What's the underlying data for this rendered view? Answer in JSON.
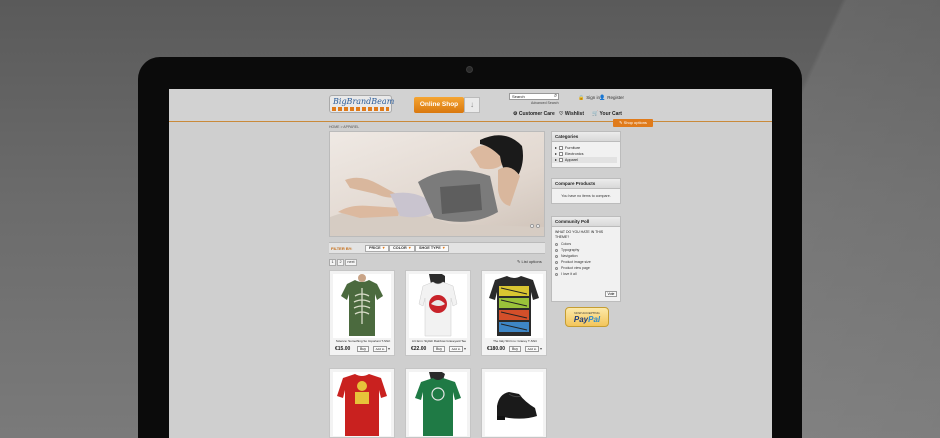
{
  "header": {
    "logo_text": "BigBrandBeam",
    "online_shop_label": "Online Shop",
    "search_placeholder": "Search",
    "advanced_search": "Advanced Search",
    "sign_in": "Sign in",
    "register": "Register",
    "customer_care": "Customer Care",
    "wishlist": "Wishlist",
    "your_cart": "Your Cart",
    "shop_options": "Shop options"
  },
  "breadcrumb": "HOME > APPAREL",
  "filter": {
    "label": "FILTER BY:",
    "chips": [
      "PRICE",
      "COLOR",
      "SHOE TYPE"
    ]
  },
  "pager": {
    "pages": [
      "1",
      "2"
    ],
    "next": "next",
    "list_options": "List options"
  },
  "products": [
    {
      "name": "Science: Something So Important T-Shirt",
      "price": "€15.00",
      "buy": "Buy",
      "add": "Add to"
    },
    {
      "name": "Art farm: Stylish Rainbow Graveyard Tee",
      "price": "€22.00",
      "buy": "Buy",
      "add": "Add to"
    },
    {
      "name": "The Italy Shirt no: Graney T-Shirt",
      "price": "€180.00",
      "buy": "Buy",
      "add": "Add to"
    }
  ],
  "sidebar": {
    "categories_title": "Categories",
    "categories": [
      "Furniture",
      "Electronics",
      "Apparel"
    ],
    "compare_title": "Compare Products",
    "compare_text": "You have no items to compare.",
    "poll_title": "Community Poll",
    "poll_question": "WHAT DO YOU HATE IN THIS THEME?",
    "poll_options": [
      "Colors",
      "Typography",
      "Navigation",
      "Product image size",
      "Product view page",
      "I love it all"
    ],
    "vote": "Vote"
  },
  "paypal": {
    "top": "NOW ACCEPTING",
    "name_a": "Pay",
    "name_b": "Pal"
  }
}
